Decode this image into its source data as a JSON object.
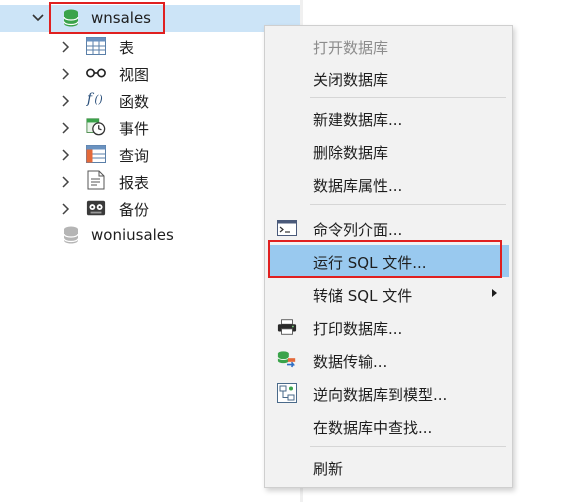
{
  "tree": {
    "database": {
      "name": "wnsales",
      "icon": "database-icon",
      "expanded": true
    },
    "children": [
      {
        "label": "表",
        "icon": "table-icon"
      },
      {
        "label": "视图",
        "icon": "view-icon"
      },
      {
        "label": "函数",
        "icon": "function-icon"
      },
      {
        "label": "事件",
        "icon": "event-icon"
      },
      {
        "label": "查询",
        "icon": "query-icon"
      },
      {
        "label": "报表",
        "icon": "report-icon"
      },
      {
        "label": "备份",
        "icon": "backup-icon"
      }
    ],
    "other_database": {
      "name": "woniusales",
      "icon": "database-icon"
    }
  },
  "context_menu": {
    "items": [
      {
        "label": "打开数据库",
        "disabled": true
      },
      {
        "label": "关闭数据库"
      },
      {
        "label": "新建数据库..."
      },
      {
        "label": "删除数据库"
      },
      {
        "label": "数据库属性..."
      },
      {
        "label": "命令列介面...",
        "icon": "console-icon"
      },
      {
        "label": "运行 SQL 文件...",
        "highlighted": true
      },
      {
        "label": "转储 SQL 文件",
        "submenu": true
      },
      {
        "label": "打印数据库...",
        "icon": "printer-icon"
      },
      {
        "label": "数据传输...",
        "icon": "data-transfer-icon"
      },
      {
        "label": "逆向数据库到模型...",
        "icon": "model-icon"
      },
      {
        "label": "在数据库中查找..."
      },
      {
        "label": "刷新"
      }
    ]
  },
  "colors": {
    "selection": "#cce4f7",
    "menu_highlight": "#99c9ef",
    "annotation_red": "#e02020",
    "database_green": "#3aa34a"
  }
}
